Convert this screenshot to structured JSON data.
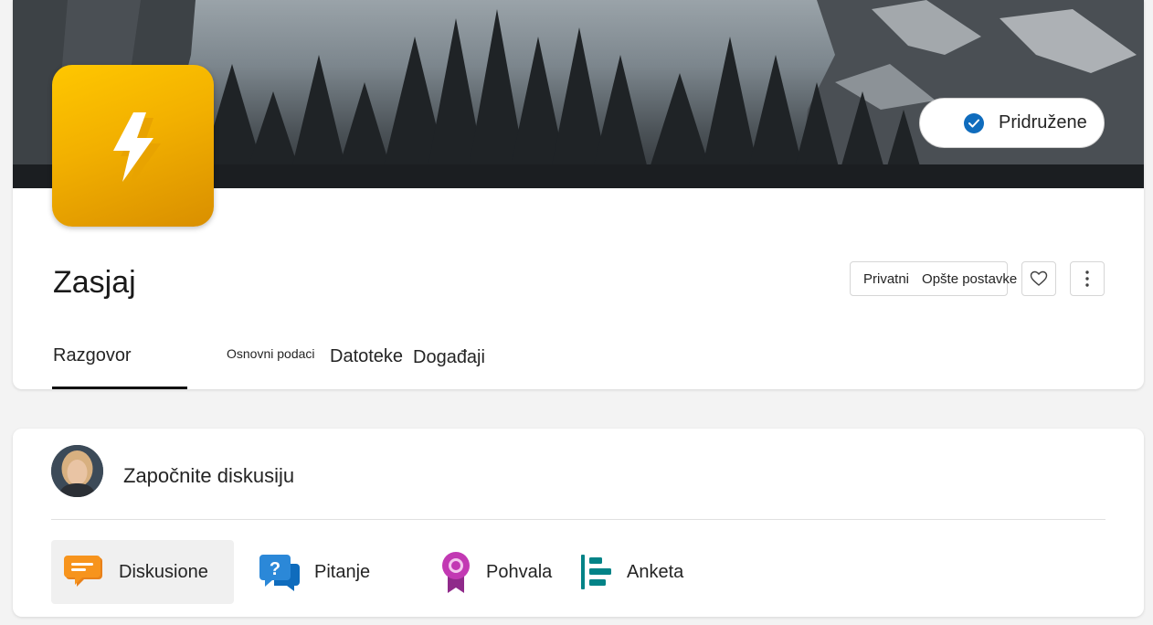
{
  "header": {
    "title": "Zasjaj",
    "joined_label": "Pridružene",
    "privacy": "Privatni",
    "settings": "Opšte postavke"
  },
  "tabs": [
    {
      "label": "Razgovor",
      "selected": true
    },
    {
      "label": "Osnovni podaci"
    },
    {
      "label": "Datoteke"
    },
    {
      "label": "Događaji"
    }
  ],
  "composer": {
    "prompt": "Započnite diskusiju",
    "post_types": [
      {
        "label": "Diskusione",
        "icon": "discussion-icon",
        "selected": true
      },
      {
        "label": "Pitanje",
        "icon": "question-icon"
      },
      {
        "label": "Pohvala",
        "icon": "praise-icon"
      },
      {
        "label": "Anketa",
        "icon": "poll-icon"
      }
    ]
  },
  "colors": {
    "logo": "#f2b000",
    "accent": "#0f6cbd",
    "discussion": "#f7941d",
    "question": "#2b88d8",
    "praise": "#c239b3",
    "poll": "#038387"
  }
}
